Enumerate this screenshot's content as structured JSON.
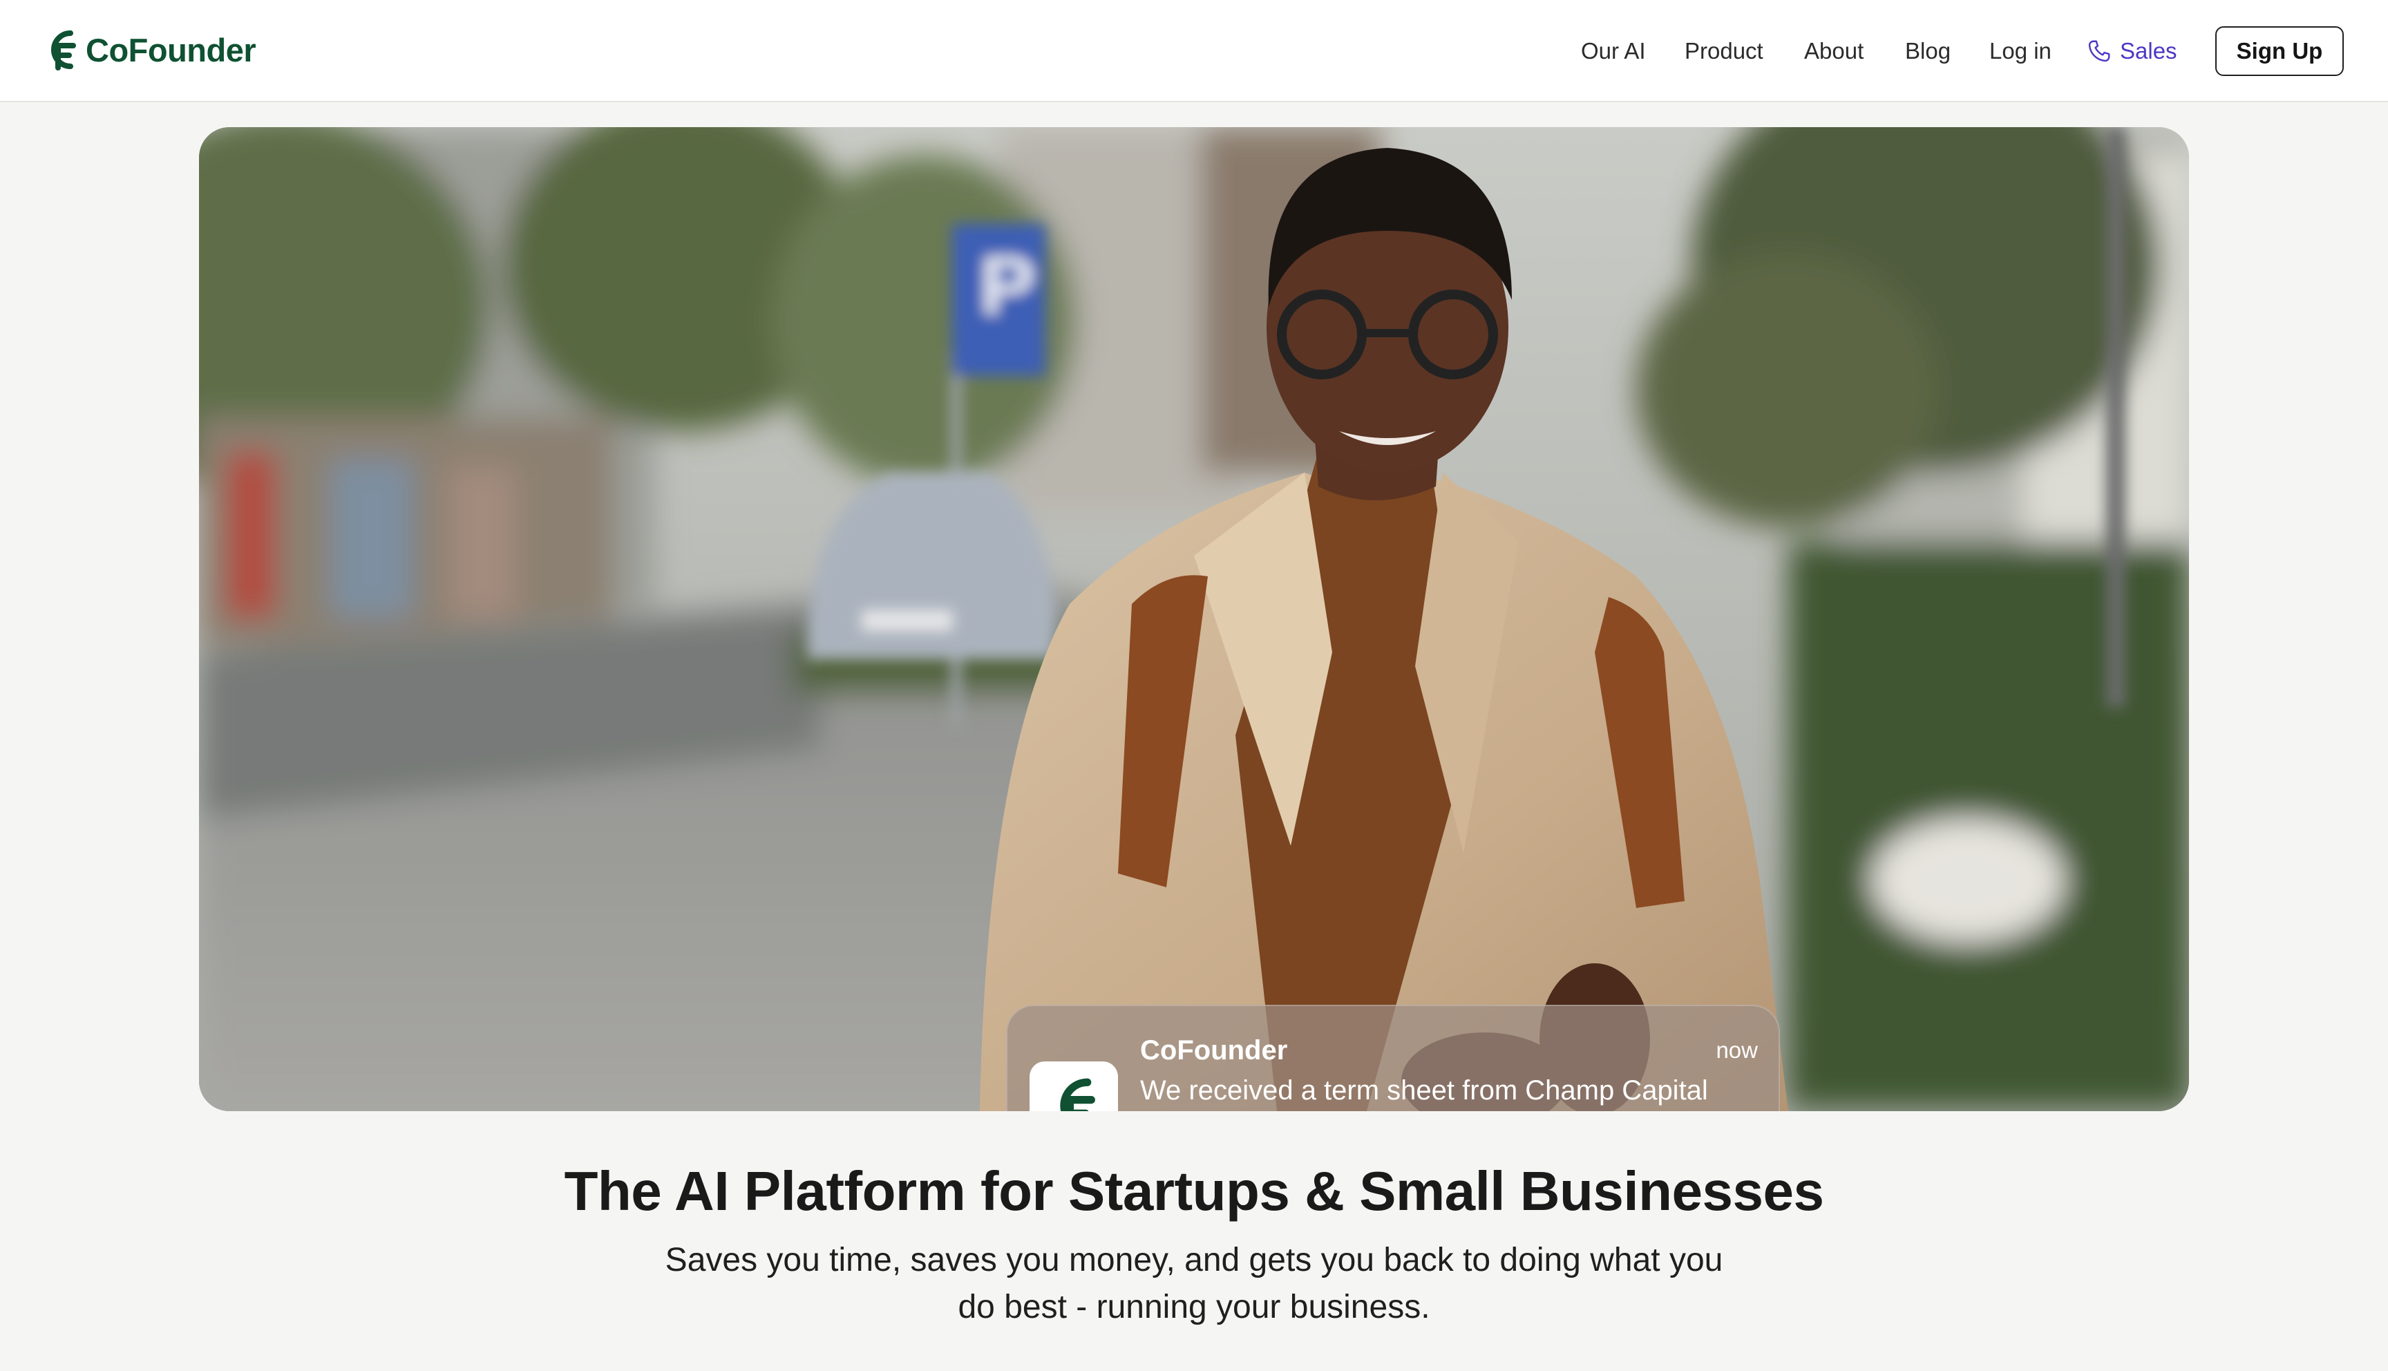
{
  "header": {
    "brand": "CoFounder",
    "nav": {
      "our_ai": "Our AI",
      "product": "Product",
      "about": "About",
      "blog": "Blog",
      "login": "Log in",
      "sales": "Sales"
    },
    "signup": "Sign Up"
  },
  "hero": {
    "notification": {
      "app_name": "CoFounder",
      "time": "now",
      "message": "We received a term sheet from Champ Capital Partners - I've marked it up, and left some thoughts - looks great overall!"
    }
  },
  "content": {
    "headline": "The AI Platform for Startups & Small Businesses",
    "subheadline": "Saves you time, saves you money, and gets you back to doing what you do best - running your business."
  },
  "colors": {
    "brand": "#0f5132",
    "sales_link": "#4c37c4",
    "page_bg": "#f5f5f4"
  },
  "icons": {
    "logo": "cofounder-logo-icon",
    "phone": "phone-icon",
    "app": "cofounder-app-icon"
  }
}
